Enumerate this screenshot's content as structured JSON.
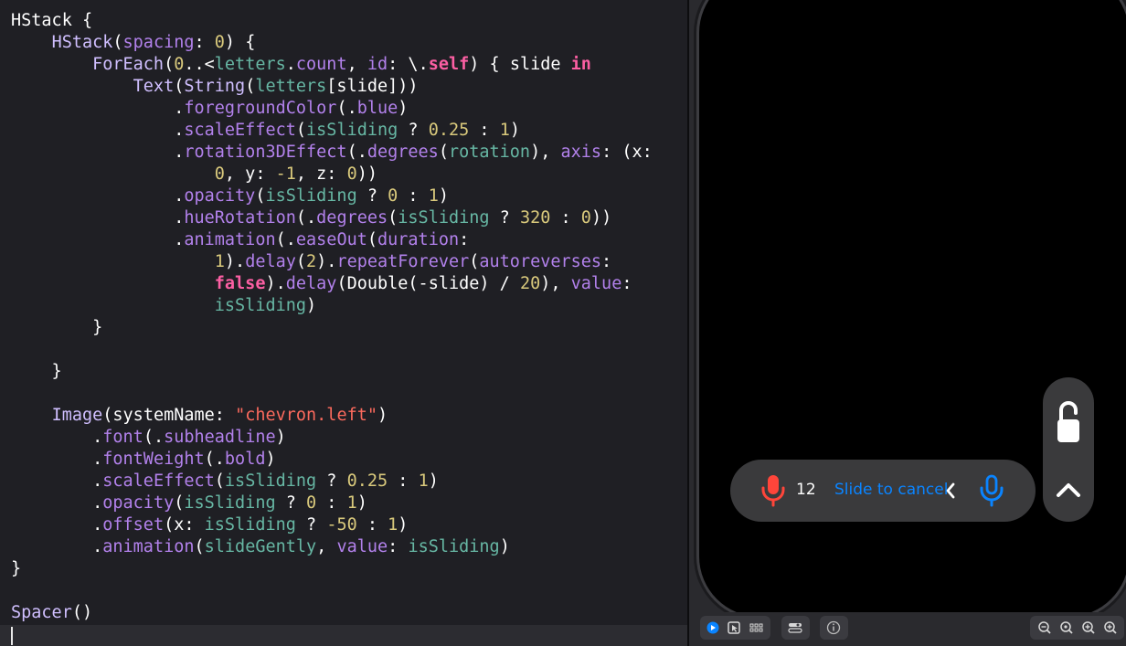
{
  "code": {
    "lines": [
      [
        [
          "HStack {",
          "t-plain"
        ]
      ],
      [
        [
          "    ",
          "t-plain"
        ],
        [
          "HStack",
          "t-type"
        ],
        [
          "(",
          "t-plain"
        ],
        [
          "spacing",
          "t-fn"
        ],
        [
          ": ",
          "t-plain"
        ],
        [
          "0",
          "t-num"
        ],
        [
          ") {",
          "t-plain"
        ]
      ],
      [
        [
          "        ",
          "t-plain"
        ],
        [
          "ForEach",
          "t-type"
        ],
        [
          "(",
          "t-plain"
        ],
        [
          "0",
          "t-num"
        ],
        [
          "..<",
          "t-plain"
        ],
        [
          "letters",
          "t-var"
        ],
        [
          ".",
          "t-plain"
        ],
        [
          "count",
          "t-fn"
        ],
        [
          ", ",
          "t-plain"
        ],
        [
          "id",
          "t-fn"
        ],
        [
          ": \\.",
          "t-plain"
        ],
        [
          "self",
          "t-kw"
        ],
        [
          ") { slide ",
          "t-plain"
        ],
        [
          "in",
          "t-kw"
        ]
      ],
      [
        [
          "            ",
          "t-plain"
        ],
        [
          "Text",
          "t-type"
        ],
        [
          "(",
          "t-plain"
        ],
        [
          "String",
          "t-type"
        ],
        [
          "(",
          "t-plain"
        ],
        [
          "letters",
          "t-var"
        ],
        [
          "[slide]))",
          "t-plain"
        ]
      ],
      [
        [
          "                .",
          "t-plain"
        ],
        [
          "foregroundColor",
          "t-fn"
        ],
        [
          "(.",
          "t-plain"
        ],
        [
          "blue",
          "t-fn"
        ],
        [
          ")",
          "t-plain"
        ]
      ],
      [
        [
          "                .",
          "t-plain"
        ],
        [
          "scaleEffect",
          "t-fn"
        ],
        [
          "(",
          "t-plain"
        ],
        [
          "isSliding",
          "t-var"
        ],
        [
          " ? ",
          "t-plain"
        ],
        [
          "0.25",
          "t-num"
        ],
        [
          " : ",
          "t-plain"
        ],
        [
          "1",
          "t-num"
        ],
        [
          ")",
          "t-plain"
        ]
      ],
      [
        [
          "                .",
          "t-plain"
        ],
        [
          "rotation3DEffect",
          "t-fn"
        ],
        [
          "(.",
          "t-plain"
        ],
        [
          "degrees",
          "t-fn"
        ],
        [
          "(",
          "t-plain"
        ],
        [
          "rotation",
          "t-var"
        ],
        [
          "), ",
          "t-plain"
        ],
        [
          "axis",
          "t-fn"
        ],
        [
          ": (x:",
          "t-plain"
        ]
      ],
      [
        [
          "                    ",
          "t-plain"
        ],
        [
          "0",
          "t-num"
        ],
        [
          ", y: ",
          "t-plain"
        ],
        [
          "-1",
          "t-num"
        ],
        [
          ", z: ",
          "t-plain"
        ],
        [
          "0",
          "t-num"
        ],
        [
          "))",
          "t-plain"
        ]
      ],
      [
        [
          "                .",
          "t-plain"
        ],
        [
          "opacity",
          "t-fn"
        ],
        [
          "(",
          "t-plain"
        ],
        [
          "isSliding",
          "t-var"
        ],
        [
          " ? ",
          "t-plain"
        ],
        [
          "0",
          "t-num"
        ],
        [
          " : ",
          "t-plain"
        ],
        [
          "1",
          "t-num"
        ],
        [
          ")",
          "t-plain"
        ]
      ],
      [
        [
          "                .",
          "t-plain"
        ],
        [
          "hueRotation",
          "t-fn"
        ],
        [
          "(.",
          "t-plain"
        ],
        [
          "degrees",
          "t-fn"
        ],
        [
          "(",
          "t-plain"
        ],
        [
          "isSliding",
          "t-var"
        ],
        [
          " ? ",
          "t-plain"
        ],
        [
          "320",
          "t-num"
        ],
        [
          " : ",
          "t-plain"
        ],
        [
          "0",
          "t-num"
        ],
        [
          "))",
          "t-plain"
        ]
      ],
      [
        [
          "                .",
          "t-plain"
        ],
        [
          "animation",
          "t-fn"
        ],
        [
          "(.",
          "t-plain"
        ],
        [
          "easeOut",
          "t-fn"
        ],
        [
          "(",
          "t-plain"
        ],
        [
          "duration",
          "t-fn"
        ],
        [
          ":",
          "t-plain"
        ]
      ],
      [
        [
          "                    ",
          "t-plain"
        ],
        [
          "1",
          "t-num"
        ],
        [
          ").",
          "t-plain"
        ],
        [
          "delay",
          "t-fn"
        ],
        [
          "(",
          "t-plain"
        ],
        [
          "2",
          "t-num"
        ],
        [
          ").",
          "t-plain"
        ],
        [
          "repeatForever",
          "t-fn"
        ],
        [
          "(",
          "t-plain"
        ],
        [
          "autoreverses",
          "t-fn"
        ],
        [
          ":",
          "t-plain"
        ]
      ],
      [
        [
          "                    ",
          "t-plain"
        ],
        [
          "false",
          "t-kw"
        ],
        [
          ").",
          "t-plain"
        ],
        [
          "delay",
          "t-fn"
        ],
        [
          "(Double(-slide) / ",
          "t-plain"
        ],
        [
          "20",
          "t-num"
        ],
        [
          "), ",
          "t-plain"
        ],
        [
          "value",
          "t-fn"
        ],
        [
          ":",
          "t-plain"
        ]
      ],
      [
        [
          "                    ",
          "t-plain"
        ],
        [
          "isSliding",
          "t-var"
        ],
        [
          ")",
          "t-plain"
        ]
      ],
      [
        [
          "        }",
          "t-plain"
        ]
      ],
      [
        [
          "",
          "t-plain"
        ]
      ],
      [
        [
          "    }",
          "t-plain"
        ]
      ],
      [
        [
          "",
          "t-plain"
        ]
      ],
      [
        [
          "    ",
          "t-plain"
        ],
        [
          "Image",
          "t-type"
        ],
        [
          "(systemName: ",
          "t-plain"
        ],
        [
          "\"chevron.left\"",
          "t-str"
        ],
        [
          ")",
          "t-plain"
        ]
      ],
      [
        [
          "        .",
          "t-plain"
        ],
        [
          "font",
          "t-fn"
        ],
        [
          "(.",
          "t-plain"
        ],
        [
          "subheadline",
          "t-fn"
        ],
        [
          ")",
          "t-plain"
        ]
      ],
      [
        [
          "        .",
          "t-plain"
        ],
        [
          "fontWeight",
          "t-fn"
        ],
        [
          "(.",
          "t-plain"
        ],
        [
          "bold",
          "t-fn"
        ],
        [
          ")",
          "t-plain"
        ]
      ],
      [
        [
          "        .",
          "t-plain"
        ],
        [
          "scaleEffect",
          "t-fn"
        ],
        [
          "(",
          "t-plain"
        ],
        [
          "isSliding",
          "t-var"
        ],
        [
          " ? ",
          "t-plain"
        ],
        [
          "0.25",
          "t-num"
        ],
        [
          " : ",
          "t-plain"
        ],
        [
          "1",
          "t-num"
        ],
        [
          ")",
          "t-plain"
        ]
      ],
      [
        [
          "        .",
          "t-plain"
        ],
        [
          "opacity",
          "t-fn"
        ],
        [
          "(",
          "t-plain"
        ],
        [
          "isSliding",
          "t-var"
        ],
        [
          " ? ",
          "t-plain"
        ],
        [
          "0",
          "t-num"
        ],
        [
          " : ",
          "t-plain"
        ],
        [
          "1",
          "t-num"
        ],
        [
          ")",
          "t-plain"
        ]
      ],
      [
        [
          "        .",
          "t-plain"
        ],
        [
          "offset",
          "t-fn"
        ],
        [
          "(x: ",
          "t-plain"
        ],
        [
          "isSliding",
          "t-var"
        ],
        [
          " ? ",
          "t-plain"
        ],
        [
          "-50",
          "t-num"
        ],
        [
          " : ",
          "t-plain"
        ],
        [
          "1",
          "t-num"
        ],
        [
          ")",
          "t-plain"
        ]
      ],
      [
        [
          "        .",
          "t-plain"
        ],
        [
          "animation",
          "t-fn"
        ],
        [
          "(",
          "t-plain"
        ],
        [
          "slideGently",
          "t-var"
        ],
        [
          ", ",
          "t-plain"
        ],
        [
          "value",
          "t-fn"
        ],
        [
          ": ",
          "t-plain"
        ],
        [
          "isSliding",
          "t-var"
        ],
        [
          ")",
          "t-plain"
        ]
      ],
      [
        [
          "}",
          "t-plain"
        ]
      ],
      [
        [
          "",
          "t-plain"
        ]
      ],
      [
        [
          "Spacer",
          "t-type"
        ],
        [
          "()",
          "t-plain"
        ]
      ]
    ]
  },
  "preview": {
    "record_count": "12",
    "slide_to_cancel": "Slide to cancel",
    "colors": {
      "mic_red": "#ff453a",
      "accent_blue": "#0a84ff",
      "pill_bg": "#3a3a3c"
    },
    "icons": [
      "mic-icon",
      "chevron-left-icon",
      "lock-open-icon",
      "chevron-up-icon"
    ]
  },
  "toolbar": {
    "buttons": [
      "live-play-icon",
      "selectable-icon",
      "variants-grid-icon",
      "device-settings-icon",
      "info-icon",
      "zoom-out-icon",
      "zoom-fit-icon",
      "zoom-100-icon",
      "zoom-in-icon"
    ]
  }
}
